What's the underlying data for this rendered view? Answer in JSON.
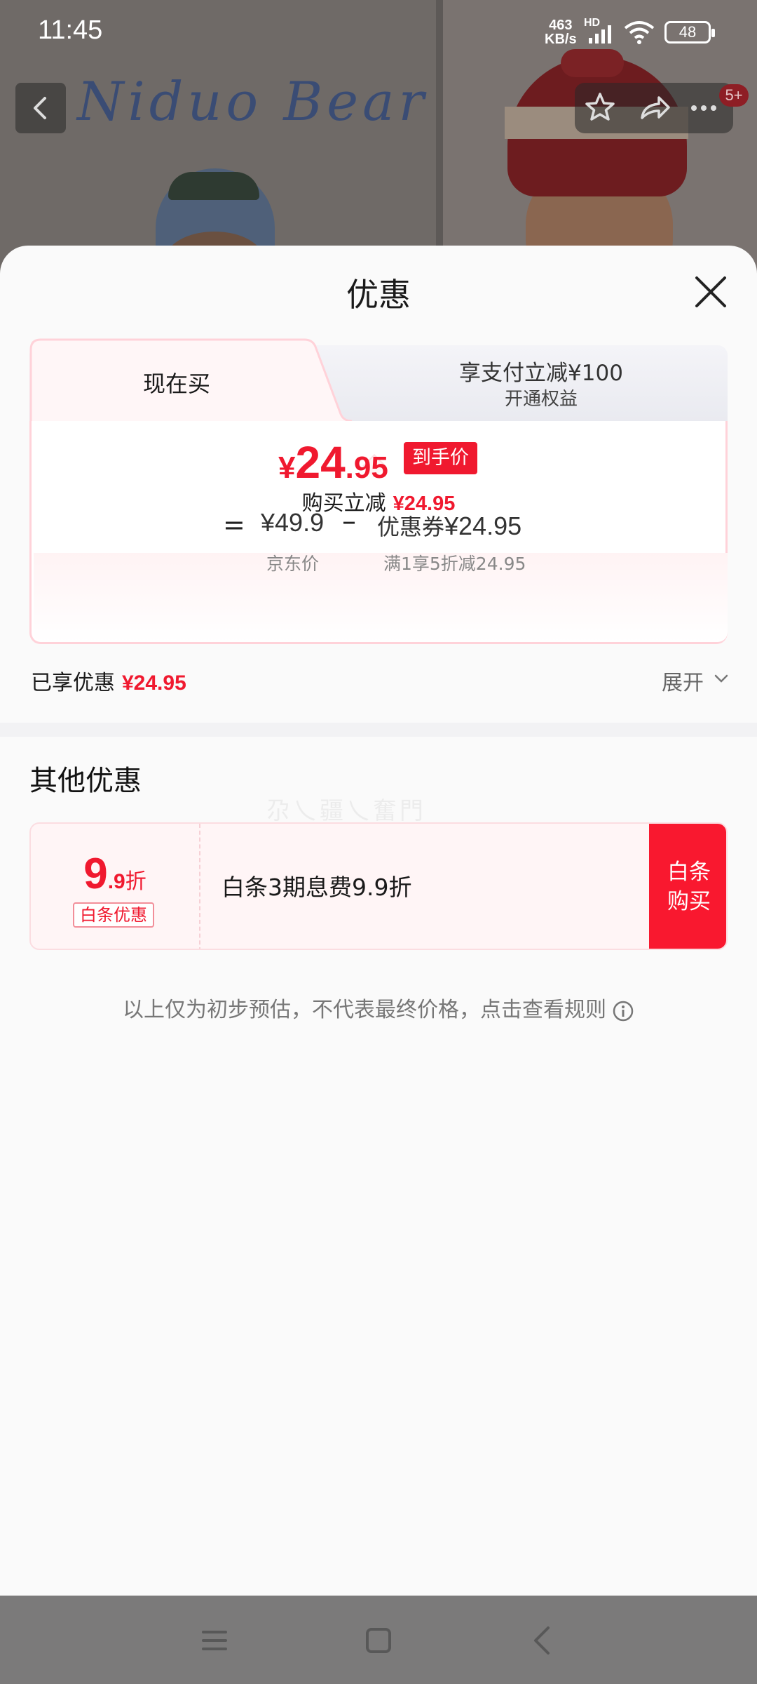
{
  "status_bar": {
    "time": "11:45",
    "net_speed_value": "463",
    "net_speed_unit": "KB/s",
    "hd": "HD",
    "battery": "48"
  },
  "product_header": {
    "brand": "Niduo Bear",
    "cart_badge": "5+"
  },
  "sheet": {
    "title": "优惠"
  },
  "tabs": [
    {
      "label": "现在买"
    },
    {
      "label": "享支付立减¥100",
      "sub": "开通权益"
    }
  ],
  "price": {
    "currency": "¥",
    "integer": "24",
    "decimal": ".95",
    "tag": "到手价",
    "reduce_label": "购买立减",
    "reduce_amount": "¥24.95"
  },
  "formula": {
    "eq": "=",
    "jd_price": "¥49.9",
    "minus": "–",
    "coupon_label": "优惠券",
    "coupon_amount": "¥24.95",
    "jd_price_label": "京东价",
    "coupon_rule": "满1享5折减24.95"
  },
  "enjoyed": {
    "label": "已享优惠",
    "amount": "¥24.95",
    "expand_label": "展开"
  },
  "other": {
    "title": "其他优惠",
    "watermark": "尕乀疆乀奮門",
    "promo": {
      "discount_big": "9",
      "discount_small": ".9",
      "discount_unit": "折",
      "tag": "白条优惠",
      "description": "白条3期息费9.9折",
      "button_line1": "白条",
      "button_line2": "购买"
    }
  },
  "disclaimer": "以上仅为初步预估，不代表最终价格，点击查看规则",
  "colors": {
    "accent_red": "#f0192f",
    "sheet_bg": "#fafafa",
    "card_border": "#ffd2d9"
  },
  "icons": [
    "back-icon",
    "star-icon",
    "share-icon",
    "more-icon",
    "close-icon",
    "chevron-down-icon",
    "info-icon",
    "menu-icon",
    "home-icon",
    "nav-back-icon"
  ]
}
